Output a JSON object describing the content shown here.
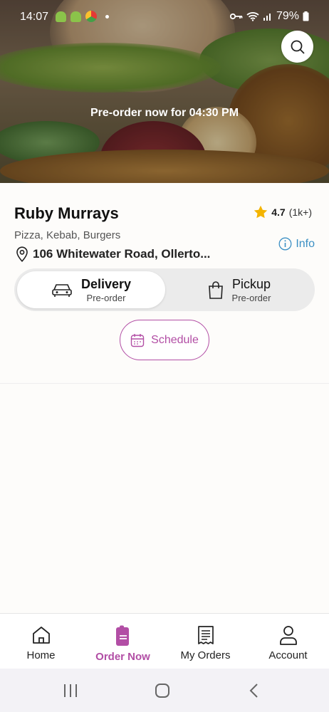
{
  "status": {
    "time": "14:07",
    "battery": "79%"
  },
  "hero": {
    "preorder_text": "Pre-order now for 04:30 PM"
  },
  "restaurant": {
    "name": "Ruby Murrays",
    "rating": "4.7",
    "rating_count": "(1k+)",
    "cuisine": "Pizza, Kebab, Burgers",
    "address": "106 Whitewater Road, Ollerto...",
    "info_label": "Info"
  },
  "order_mode": {
    "options": [
      {
        "title": "Delivery",
        "subtitle": "Pre-order",
        "icon": "car-icon",
        "selected": true
      },
      {
        "title": "Pickup",
        "subtitle": "Pre-order",
        "icon": "bag-icon",
        "selected": false
      }
    ],
    "schedule_label": "Schedule"
  },
  "bottom_nav": {
    "items": [
      {
        "label": "Home",
        "icon": "home-icon",
        "active": false
      },
      {
        "label": "Order Now",
        "icon": "menu-card-icon",
        "active": true
      },
      {
        "label": "My Orders",
        "icon": "receipt-icon",
        "active": false
      },
      {
        "label": "Account",
        "icon": "user-icon",
        "active": false
      }
    ]
  },
  "colors": {
    "accent": "#b24ea5",
    "link": "#3b8fc4",
    "star": "#f4b400"
  }
}
